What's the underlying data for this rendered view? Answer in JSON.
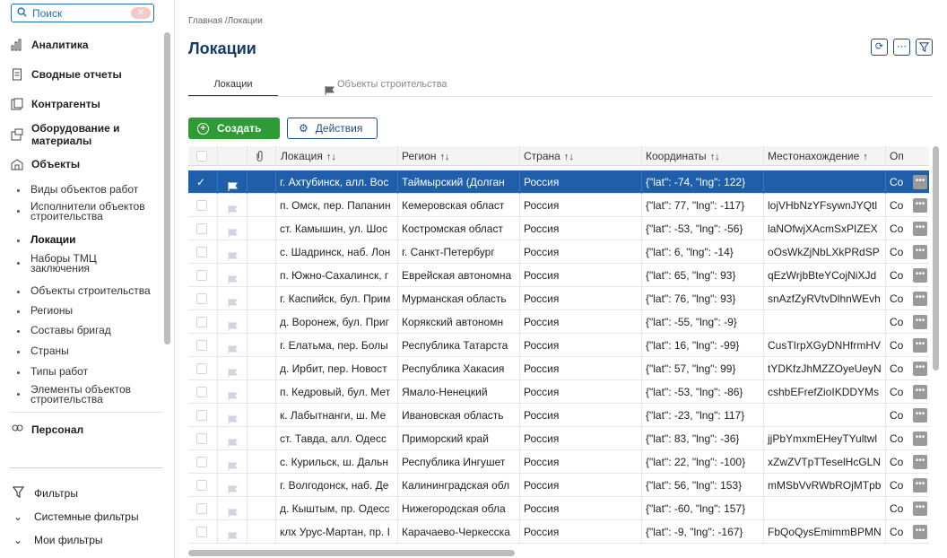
{
  "sidebar": {
    "search_label": "Поиск",
    "groups": [
      {
        "label": "Аналитика",
        "icon": "chart-icon"
      },
      {
        "label": "Сводные отчеты",
        "icon": "document-icon"
      },
      {
        "label": "Контрагенты",
        "icon": "contacts-icon"
      },
      {
        "label": "Оборудование и материалы",
        "icon": "box-icon"
      },
      {
        "label": "Объекты",
        "icon": "building-icon"
      }
    ],
    "items": [
      {
        "label": "Виды объектов работ"
      },
      {
        "label": "Исполнители объектов строительства"
      },
      {
        "label": "Локации"
      },
      {
        "label": "Наборы ТМЦ заключения"
      },
      {
        "label": "Объекты строительства"
      },
      {
        "label": "Регионы"
      },
      {
        "label": "Составы бригад"
      },
      {
        "label": "Страны"
      },
      {
        "label": "Типы работ"
      },
      {
        "label": "Элементы объектов строительства"
      }
    ],
    "next_group": "Персонал",
    "filters": {
      "title": "Фильтры",
      "system": "Системные фильтры",
      "mine": "Мои фильтры"
    }
  },
  "main": {
    "breadcrumb": "Главная /Локации",
    "title": "Локации",
    "tabs": [
      "Локации",
      "Объекты строительства"
    ],
    "create_label": "Создать",
    "actions_label": "Действия"
  },
  "table": {
    "columns": [
      "Локация",
      "Регион",
      "Страна",
      "Координаты",
      "Местонахождение",
      "Оп"
    ],
    "rows": [
      [
        "г. Ахтубинск, алл. Вос",
        "Таймырский (Долган",
        "Россия",
        "{\"lat\": -74, \"lng\": 122}",
        "",
        "Co"
      ],
      [
        "п. Омск, пер. Папанин",
        "Кемеровская област",
        "Россия",
        "{\"lat\": 77, \"lng\": -117}",
        "lojVHbNzYFsywnJYQtl",
        "Co"
      ],
      [
        "ст. Камышин, ул. Шос",
        "Костромская област",
        "Россия",
        "{\"lat\": -53, \"lng\": -56}",
        "laNOfwjXAcmSxPIZEX",
        "Co"
      ],
      [
        "с. Шадринск, наб. Лон",
        "г. Санкт-Петербург",
        "Россия",
        "{\"lat\": 6, \"lng\": -14}",
        "oOsWkZjNbLXkPRdSP",
        "Co"
      ],
      [
        "п. Южно-Сахалинск, г",
        "Еврейская автономна",
        "Россия",
        "{\"lat\": 65, \"lng\": 93}",
        "qEzWrjbBteYCojNiXJd",
        "Co"
      ],
      [
        "г. Каспийск, бул. Прим",
        "Мурманская область",
        "Россия",
        "{\"lat\": 76, \"lng\": 93}",
        "snAzfZyRVtvDlhnWEvh",
        "Co"
      ],
      [
        "д. Воронеж, бул. Приг",
        "Корякский автономн",
        "Россия",
        "{\"lat\": -55, \"lng\": -9}",
        "",
        "Co"
      ],
      [
        "г. Елатьма, пер. Болы",
        "Республика Татарста",
        "Россия",
        "{\"lat\": 16, \"lng\": -99}",
        "CusTIrpXGyDNHfrmHV",
        "Co"
      ],
      [
        "д. Ирбит, пер. Новост",
        "Республика Хакасия",
        "Россия",
        "{\"lat\": 57, \"lng\": 99}",
        "tYDKfzJhMZZOyeUeyN",
        "Co"
      ],
      [
        "п. Кедровый, бул. Мет",
        "Ямало-Ненецкий",
        "Россия",
        "{\"lat\": -53, \"lng\": -86}",
        "cshbEFrefZioIKDDYMs",
        "Co"
      ],
      [
        "к. Лабытнанги, ш. Ме",
        "Ивановская область",
        "Россия",
        "{\"lat\": -23, \"lng\": 117}",
        "",
        "Co"
      ],
      [
        "ст. Тавда, алл. Одесс",
        "Приморский край",
        "Россия",
        "{\"lat\": 83, \"lng\": -36}",
        "jjPbYmxmEHeyTYultwl",
        "Co"
      ],
      [
        "с. Курильск, ш. Дальн",
        "Республика Ингушет",
        "Россия",
        "{\"lat\": 22, \"lng\": -100}",
        "xZwZVTpTTeselHcGLN",
        "Co"
      ],
      [
        "г. Волгодонск, наб. Де",
        "Калининградская обл",
        "Россия",
        "{\"lat\": 56, \"lng\": 153}",
        "mMSbVvRWbROjMTpb",
        "Co"
      ],
      [
        "д. Кыштым, пр. Одесс",
        "Нижегородская обла",
        "Россия",
        "{\"lat\": -60, \"lng\": 157}",
        "",
        "Co"
      ],
      [
        "клх Урус-Мартан, пр. I",
        "Карачаево-Черкесска",
        "Россия",
        "{\"lat\": -9, \"lng\": -167}",
        "FbQoQysEmimmBPMN",
        "Co"
      ]
    ]
  },
  "colors": {
    "accent": "#1f5ea8",
    "create": "#2e9b35",
    "title": "#143a6b"
  }
}
